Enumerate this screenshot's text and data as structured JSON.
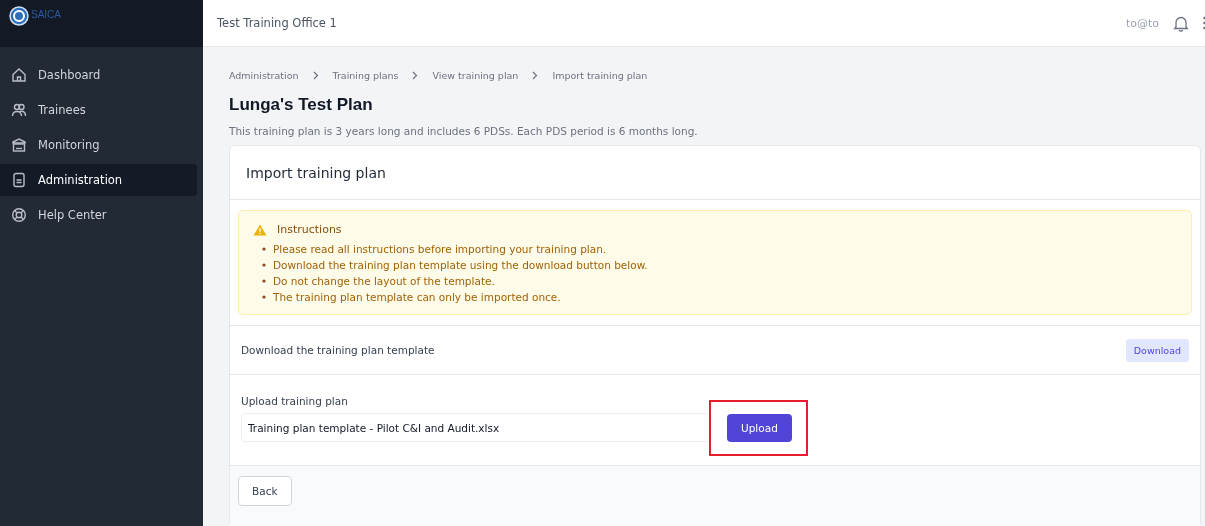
{
  "logo": {
    "text": "SAICA"
  },
  "sidebar": {
    "items": [
      {
        "label": "Dashboard",
        "kind": "home",
        "selected": false
      },
      {
        "label": "Trainees",
        "kind": "people",
        "selected": false
      },
      {
        "label": "Monitoring",
        "kind": "bank",
        "selected": false
      },
      {
        "label": "Administration",
        "kind": "document",
        "selected": true
      },
      {
        "label": "Help Center",
        "kind": "lifebuoy",
        "selected": false
      }
    ]
  },
  "topbar": {
    "title": "Test Training Office 1",
    "user": "to@to"
  },
  "breadcrumb": [
    "Administration",
    "Training plans",
    "View training plan",
    "Import training plan"
  ],
  "page": {
    "title": "Lunga's Test Plan",
    "subtitle": "This training plan is 3 years long and includes 6 PDSs. Each PDS period is 6 months long."
  },
  "card": {
    "title": "Import training plan",
    "alert": {
      "title": "Instructions",
      "items": [
        "Please read all instructions before importing your training plan.",
        "Download the training plan template using the download button below.",
        "Do not change the layout of the template.",
        "The training plan template can only be imported once."
      ]
    },
    "download": {
      "label": "Download the training plan template",
      "button": "Download"
    },
    "upload": {
      "label": "Upload training plan",
      "value": "Training plan template - Pilot C&I and Audit.xlsx",
      "button": "Upload",
      "highlighted": true
    },
    "back": "Back"
  }
}
